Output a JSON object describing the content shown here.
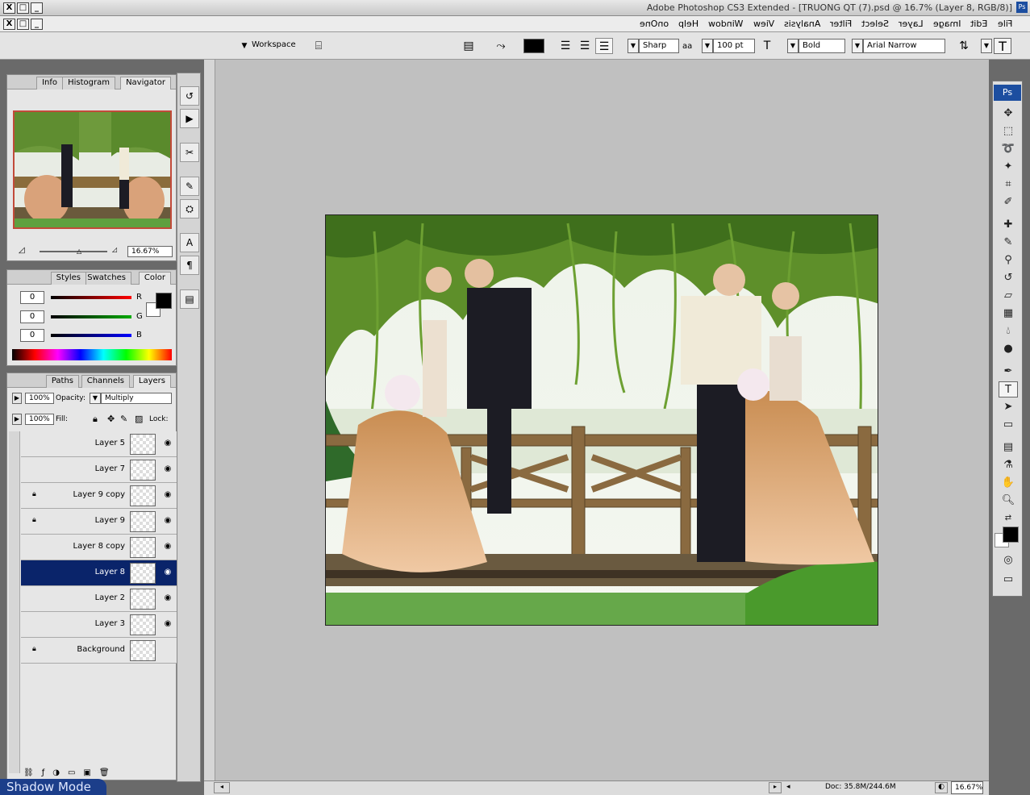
{
  "window": {
    "title": "Adobe Photoshop CS3 Extended - [TRUONG QT (7).psd @ 16.7% (Layer 8, RGB/8)]",
    "close": "X",
    "restore": "□",
    "minimize": "_"
  },
  "menu": [
    "File",
    "Edit",
    "Image",
    "Layer",
    "Select",
    "Filter",
    "Analysis",
    "View",
    "Window",
    "Help",
    "onOne"
  ],
  "options": {
    "font_family": "Arial Narrow",
    "font_style": "Bold",
    "font_size": "100 pt",
    "antialias": "Sharp",
    "aa_label": "aa",
    "workspace": "Workspace",
    "text_color": "#000000"
  },
  "navigator": {
    "tabs": [
      "Navigator",
      "Histogram",
      "Info"
    ],
    "zoom": "16.67%"
  },
  "color_panel": {
    "tabs": [
      "Color",
      "Swatches",
      "Styles"
    ],
    "r_label": "R",
    "g_label": "G",
    "b_label": "B",
    "r": "0",
    "g": "0",
    "b": "0"
  },
  "layers_panel": {
    "tabs": [
      "Layers",
      "Channels",
      "Paths"
    ],
    "blend_mode": "Multiply",
    "opacity_label": "Opacity:",
    "opacity": "100%",
    "lock_label": "Lock:",
    "fill_label": "Fill:",
    "fill": "100%",
    "layers": [
      {
        "name": "Layer 5",
        "visible": true,
        "locked": false,
        "selected": false
      },
      {
        "name": "Layer 7",
        "visible": true,
        "locked": false,
        "selected": false
      },
      {
        "name": "Layer 9 copy",
        "visible": true,
        "locked": true,
        "selected": false
      },
      {
        "name": "Layer 9",
        "visible": true,
        "locked": true,
        "selected": false
      },
      {
        "name": "Layer 8 copy",
        "visible": true,
        "locked": false,
        "selected": false
      },
      {
        "name": "Layer 8",
        "visible": true,
        "locked": false,
        "selected": true
      },
      {
        "name": "Layer 2",
        "visible": true,
        "locked": false,
        "selected": false
      },
      {
        "name": "Layer 3",
        "visible": true,
        "locked": false,
        "selected": false
      },
      {
        "name": "Background",
        "visible": false,
        "locked": true,
        "selected": false
      }
    ]
  },
  "status": {
    "zoom": "16.67%",
    "doc": "Doc: 35.8M/244.6M"
  },
  "tools_badge": "Ps",
  "shadow_mode": "Shadow Mode"
}
